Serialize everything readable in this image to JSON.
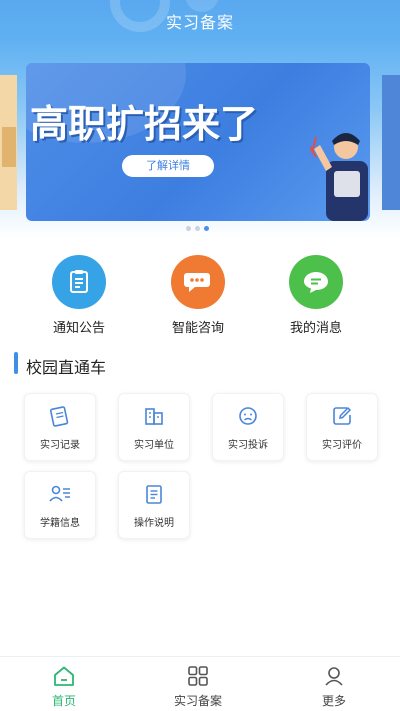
{
  "header": {
    "title": "实习备案"
  },
  "banner": {
    "headline": "高职扩招来了",
    "button_label": "了解详情",
    "active_index": 2,
    "dot_count": 3
  },
  "quick_actions": [
    {
      "label": "通知公告",
      "icon": "notice-icon",
      "color": "#35a3e6"
    },
    {
      "label": "智能咨询",
      "icon": "chat-icon",
      "color": "#f07a32"
    },
    {
      "label": "我的消息",
      "icon": "message-icon",
      "color": "#4cc04a"
    }
  ],
  "section": {
    "title": "校园直通车"
  },
  "services": [
    {
      "label": "实习记录",
      "icon": "record-icon"
    },
    {
      "label": "实习单位",
      "icon": "building-icon"
    },
    {
      "label": "实习投诉",
      "icon": "complaint-icon"
    },
    {
      "label": "实习评价",
      "icon": "edit-icon"
    },
    {
      "label": "学籍信息",
      "icon": "student-info-icon"
    },
    {
      "label": "操作说明",
      "icon": "document-icon"
    }
  ],
  "bottom_nav": {
    "tabs": [
      {
        "label": "首页",
        "icon": "home-icon",
        "active": true
      },
      {
        "label": "实习备案",
        "icon": "grid-icon",
        "active": false
      },
      {
        "label": "更多",
        "icon": "user-icon",
        "active": false
      }
    ]
  },
  "colors": {
    "accent": "#3f8fe8",
    "active_tab": "#2bb673"
  }
}
